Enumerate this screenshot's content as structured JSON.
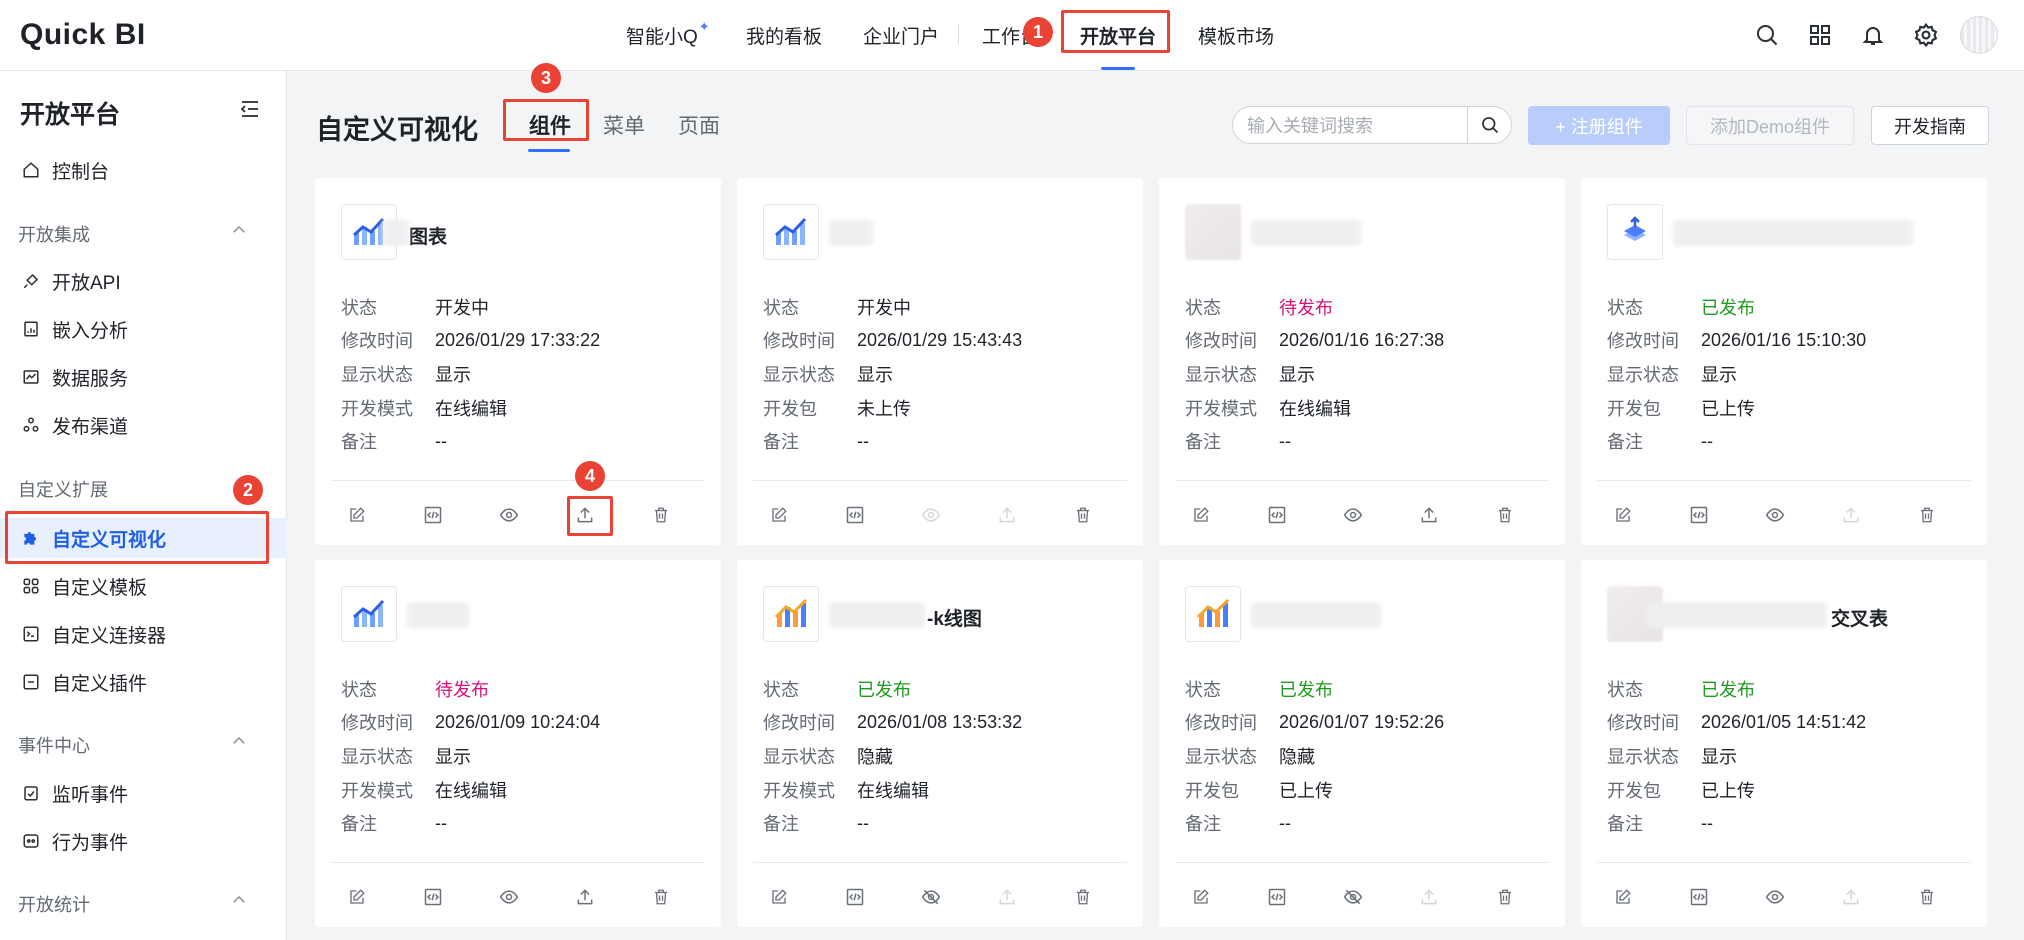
{
  "app": {
    "logo": "Quick BI"
  },
  "topnav": {
    "items": [
      "智能小Q",
      "我的看板",
      "企业门户",
      "工作台",
      "开放平台",
      "模板市场"
    ],
    "active_index": 4
  },
  "sidebar": {
    "title": "开放平台",
    "home": "控制台",
    "groups": [
      {
        "label": "开放集成",
        "items": [
          "开放API",
          "嵌入分析",
          "数据服务",
          "发布渠道"
        ]
      },
      {
        "label": "自定义扩展",
        "items": [
          "自定义可视化",
          "自定义模板",
          "自定义连接器",
          "自定义插件"
        ]
      },
      {
        "label": "事件中心",
        "items": [
          "监听事件",
          "行为事件"
        ]
      },
      {
        "label": "开放统计",
        "items": []
      }
    ],
    "active_item": "自定义可视化"
  },
  "main": {
    "title": "自定义可视化",
    "tabs": [
      "组件",
      "菜单",
      "页面"
    ],
    "active_tab": "组件",
    "search_placeholder": "输入关键词搜索",
    "buttons": {
      "register": "+ 注册组件",
      "add_demo": "添加Demo组件",
      "guide": "开发指南"
    }
  },
  "labels": {
    "status": "状态",
    "modified": "修改时间",
    "display": "显示状态",
    "dev_mode": "开发模式",
    "dev_pkg": "开发包",
    "remark": "备注"
  },
  "cards": [
    {
      "name": "图表",
      "status": "开发中",
      "modified": "2026/01/29 17:33:22",
      "display": "显示",
      "mode_label": "开发模式",
      "mode": "在线编辑",
      "remark": "--"
    },
    {
      "name": "",
      "status": "开发中",
      "modified": "2026/01/29 15:43:43",
      "display": "显示",
      "mode_label": "开发包",
      "mode": "未上传",
      "remark": "--"
    },
    {
      "name": "",
      "status": "待发布",
      "modified": "2026/01/16 16:27:38",
      "display": "显示",
      "mode_label": "开发模式",
      "mode": "在线编辑",
      "remark": "--"
    },
    {
      "name": "",
      "status": "已发布",
      "modified": "2026/01/16 15:10:30",
      "display": "显示",
      "mode_label": "开发包",
      "mode": "已上传",
      "remark": "--"
    },
    {
      "name": "",
      "status": "待发布",
      "modified": "2026/01/09 10:24:04",
      "display": "显示",
      "mode_label": "开发模式",
      "mode": "在线编辑",
      "remark": "--"
    },
    {
      "name": "-k线图",
      "status": "已发布",
      "modified": "2026/01/08 13:53:32",
      "display": "隐藏",
      "mode_label": "开发模式",
      "mode": "在线编辑",
      "remark": "--"
    },
    {
      "name": "",
      "status": "已发布",
      "modified": "2026/01/07 19:52:26",
      "display": "隐藏",
      "mode_label": "开发包",
      "mode": "已上传",
      "remark": "--"
    },
    {
      "name": "交叉表",
      "status": "已发布",
      "modified": "2026/01/05 14:51:42",
      "display": "显示",
      "mode_label": "开发包",
      "mode": "已上传",
      "remark": "--"
    }
  ],
  "annotations": [
    "1",
    "2",
    "3",
    "4"
  ],
  "colors": {
    "accent": "#3370ff",
    "published": "#1e9b1e",
    "pending": "#d6117c",
    "annotation": "#ea4336"
  }
}
